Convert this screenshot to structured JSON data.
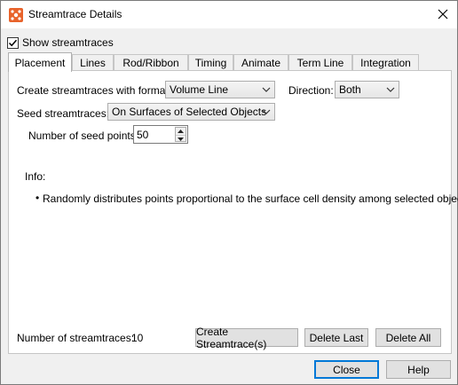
{
  "window": {
    "title": "Streamtrace Details",
    "show_streamtraces": {
      "label": "Show streamtraces",
      "checked": true
    }
  },
  "tabs": [
    {
      "label": "Placement",
      "active": true
    },
    {
      "label": "Lines"
    },
    {
      "label": "Rod/Ribbon"
    },
    {
      "label": "Timing"
    },
    {
      "label": "Animate"
    },
    {
      "label": "Term Line"
    },
    {
      "label": "Integration"
    }
  ],
  "placement": {
    "format_label": "Create streamtraces with format:",
    "format_value": "Volume Line",
    "direction_label": "Direction:",
    "direction_value": "Both",
    "seed_label": "Seed streamtraces:",
    "seed_value": "On Surfaces of Selected Objects",
    "num_seed_label": "Number of seed points:",
    "num_seed_value": "50",
    "info_label": "Info:",
    "info_text": "Randomly distributes points proportional to the surface cell density among selected objects.",
    "count_label": "Number of streamtraces:",
    "count_value": "10",
    "create_label": "Create Streamtrace(s)",
    "delete_last_label": "Delete Last",
    "delete_all_label": "Delete All"
  },
  "footer": {
    "close_label": "Close",
    "help_label": "Help"
  },
  "colors": {
    "accent": "#0078d7",
    "app_icon": "#e8632b"
  }
}
